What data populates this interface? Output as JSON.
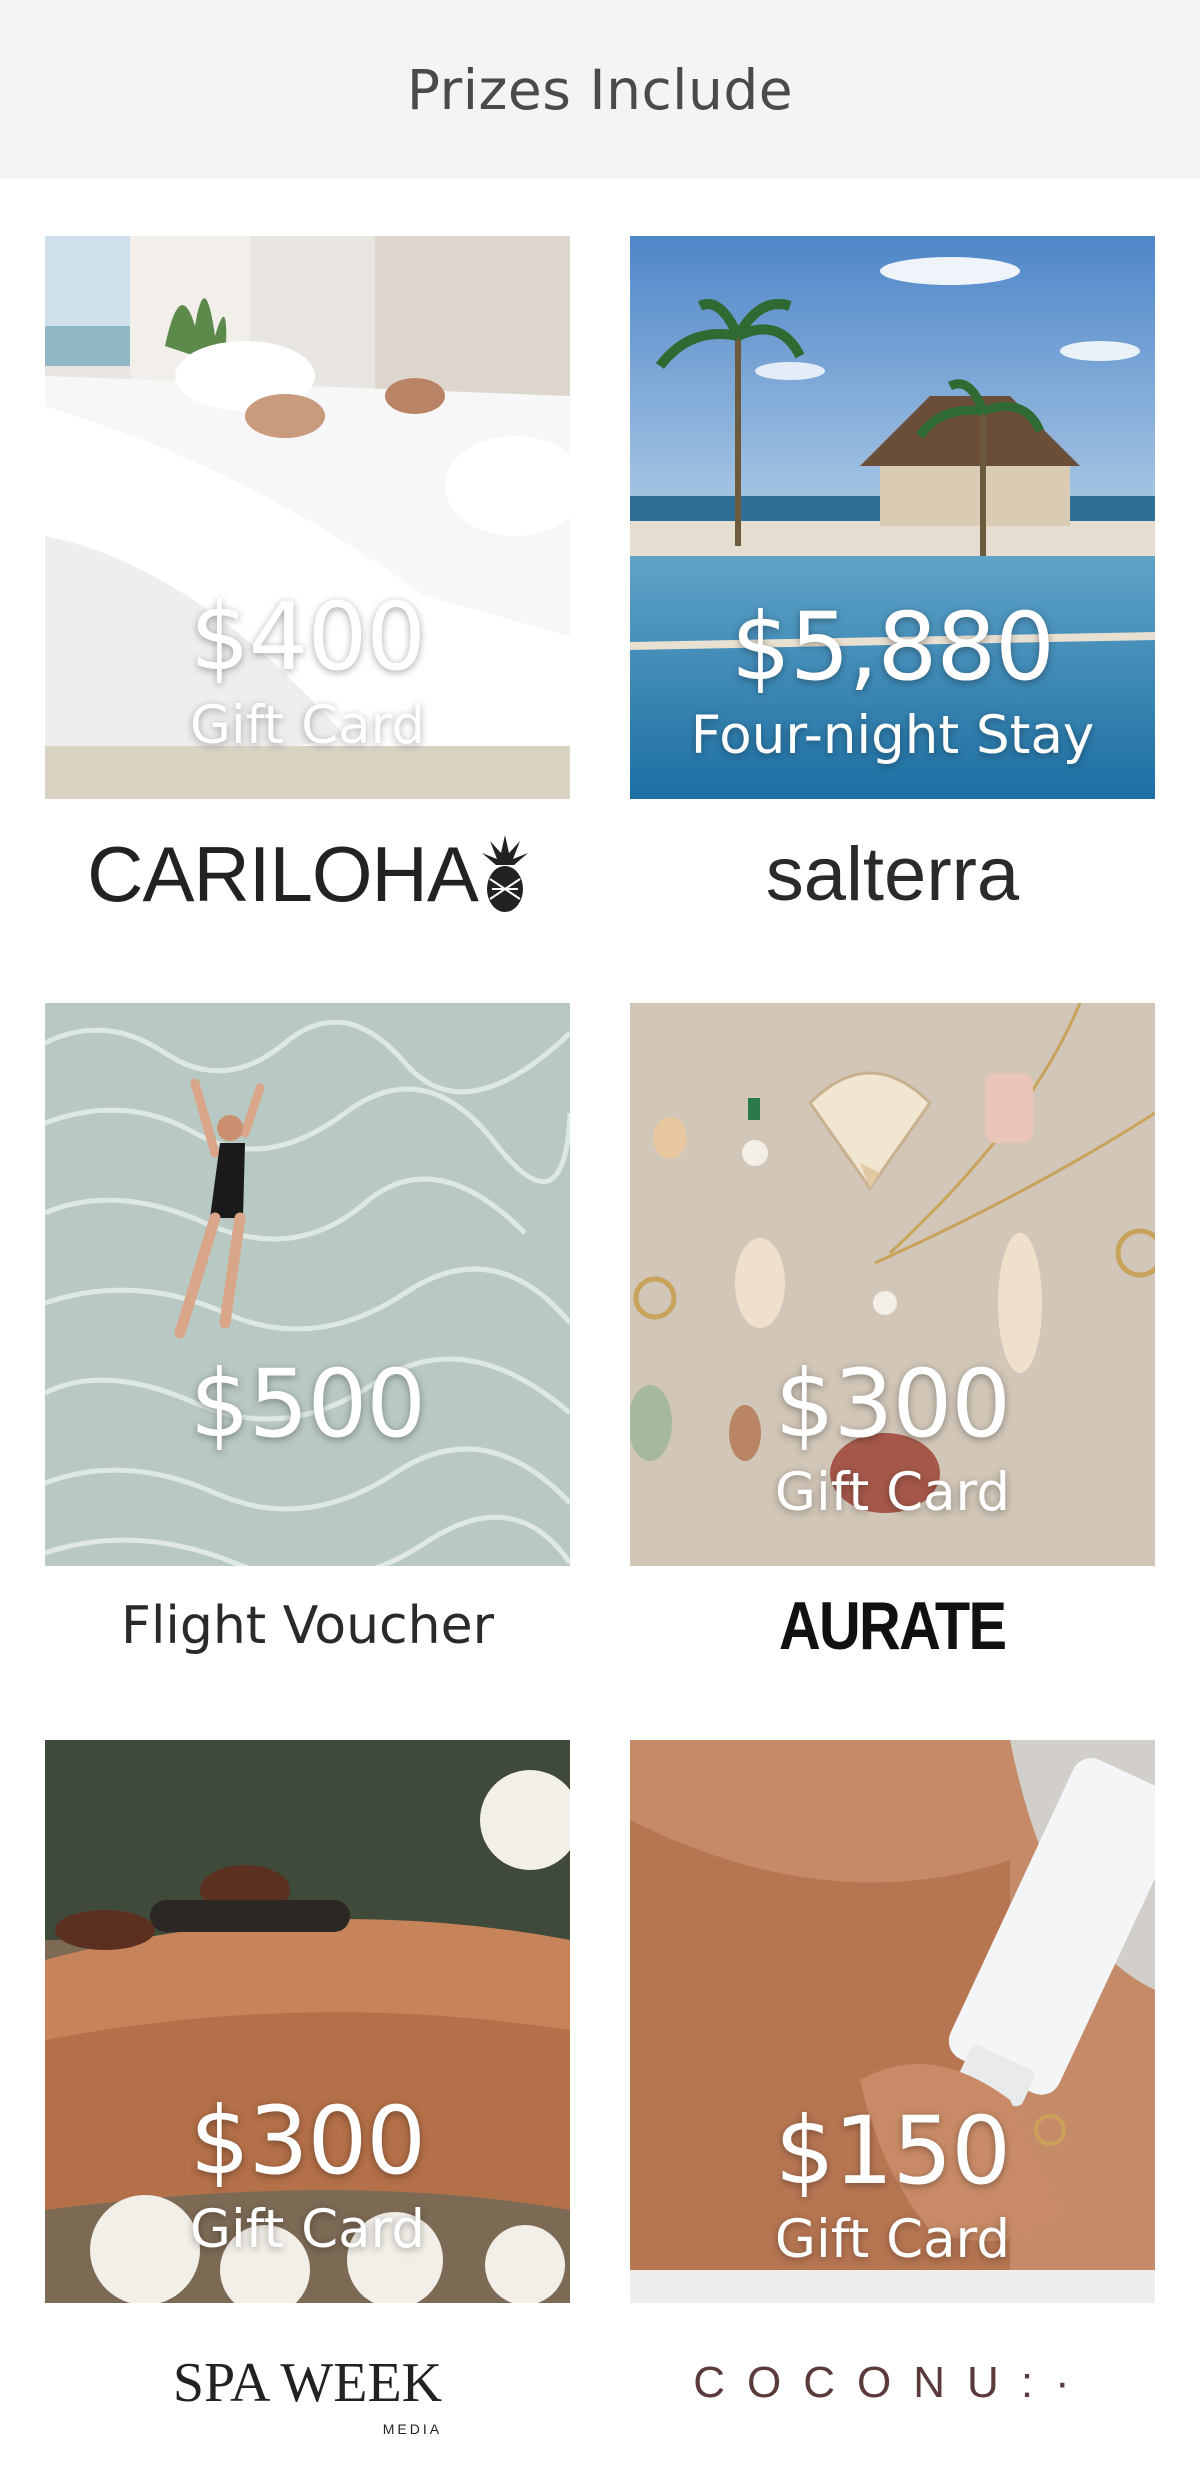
{
  "header": {
    "title": "Prizes Include"
  },
  "prizes": [
    {
      "amount": "$400",
      "description": "Gift Card",
      "brand": "CARILOHA",
      "image": "couple-sleeping-in-white-bedding"
    },
    {
      "amount": "$5,880",
      "description": "Four-night Stay",
      "brand": "salterra",
      "image": "resort-infinity-pool-palms"
    },
    {
      "amount": "$500",
      "description": "",
      "brand": "Flight Voucher",
      "image": "woman-floating-in-clear-water"
    },
    {
      "amount": "$300",
      "description": "Gift Card",
      "brand": "AURATE",
      "image": "gold-jewelry-and-seashells"
    },
    {
      "amount": "$300",
      "description": "Gift Card",
      "brand": "SPA WEEK",
      "brand_sub": "MEDIA",
      "image": "hot-stone-massage"
    },
    {
      "amount": "$150",
      "description": "Gift Card",
      "brand": "COCONU",
      "brand_suffix": ":·",
      "image": "hand-holding-coconu-lotion-tube"
    }
  ],
  "colors": {
    "header_bg": "#f3f4f6",
    "header_text": "#4a4a4a",
    "overlay_text": "#ffffff"
  }
}
